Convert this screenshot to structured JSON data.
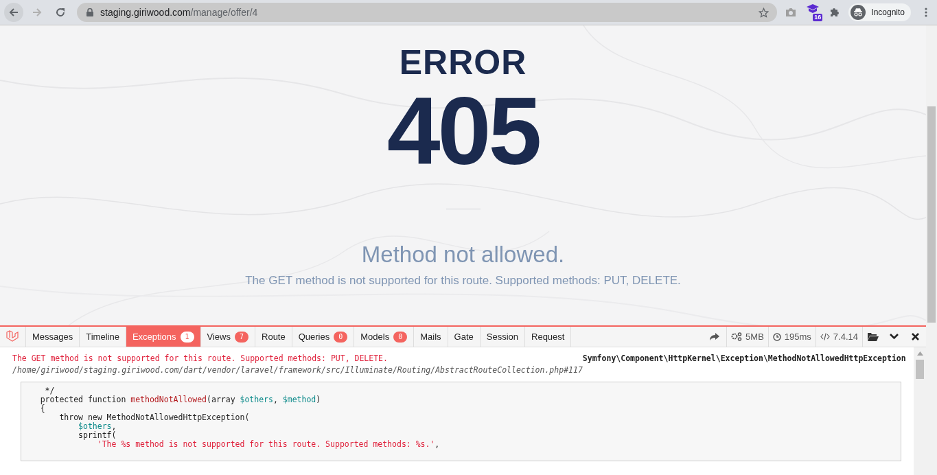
{
  "browser": {
    "url": {
      "host": "staging.giriwood.com",
      "path": "/manage/offer/4"
    },
    "extension_badge": "16",
    "profile": "Incognito"
  },
  "error": {
    "label": "ERROR",
    "code": "405",
    "title": "Method not allowed.",
    "message": "The GET method is not supported for this route. Supported methods: PUT, DELETE."
  },
  "debugbar": {
    "tabs": [
      {
        "label": "Messages",
        "selected": false
      },
      {
        "label": "Timeline",
        "selected": false
      },
      {
        "label": "Exceptions",
        "badge": "1",
        "selected": true
      },
      {
        "label": "Views",
        "badge": "7",
        "selected": false
      },
      {
        "label": "Route",
        "selected": false
      },
      {
        "label": "Queries",
        "badge": "0",
        "selected": false
      },
      {
        "label": "Models",
        "badge": "0",
        "selected": false
      },
      {
        "label": "Mails",
        "selected": false
      },
      {
        "label": "Gate",
        "selected": false
      },
      {
        "label": "Session",
        "selected": false
      },
      {
        "label": "Request",
        "selected": false
      }
    ],
    "stats": [
      {
        "kind": "memory",
        "text": "5MB"
      },
      {
        "kind": "time",
        "text": "195ms"
      },
      {
        "kind": "php",
        "text": "7.4.14"
      }
    ],
    "exception": {
      "message": "The GET method is not supported for this route. Supported methods: PUT, DELETE.",
      "file": "/home/giriwood/staging.giriwood.com/dart/vendor/laravel/framework/src/Illuminate/Routing/AbstractRouteCollection.php#117",
      "class": "Symfony\\Component\\HttpKernel\\Exception\\MethodNotAllowedHttpException",
      "code": [
        [
          {
            "kind": "plain",
            "text": "     */"
          }
        ],
        [
          {
            "kind": "plain",
            "text": "    protected function "
          },
          {
            "kind": "func",
            "text": "methodNotAllowed"
          },
          {
            "kind": "plain",
            "text": "(array "
          },
          {
            "kind": "var",
            "text": "$others"
          },
          {
            "kind": "plain",
            "text": ", "
          },
          {
            "kind": "var",
            "text": "$method"
          },
          {
            "kind": "plain",
            "text": ")"
          }
        ],
        [
          {
            "kind": "plain",
            "text": "    {"
          }
        ],
        [
          {
            "kind": "plain",
            "text": "        throw new MethodNotAllowedHttpException("
          }
        ],
        [
          {
            "kind": "var",
            "text": "            $others"
          },
          {
            "kind": "plain",
            "text": ","
          }
        ],
        [
          {
            "kind": "plain",
            "text": "            sprintf("
          }
        ],
        [
          {
            "kind": "str",
            "text": "                'The %s method is not supported for this route. Supported methods: %s.'"
          },
          {
            "kind": "plain",
            "text": ","
          }
        ]
      ]
    }
  }
}
